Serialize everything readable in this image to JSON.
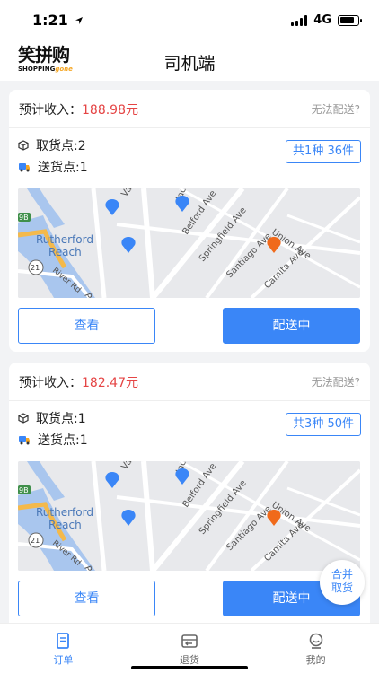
{
  "status_bar": {
    "time": "1:21",
    "network": "4G"
  },
  "header": {
    "logo_cn": "笑拼购",
    "logo_en_a": "SHOPPING",
    "logo_en_b": "gone",
    "title": "司机端"
  },
  "orders": [
    {
      "income_label": "预计收入：",
      "income_value": "188.98元",
      "no_delivery": "无法配送?",
      "pickup_points": "取货点:2",
      "delivery_points": "送货点:1",
      "summary": "共1种  36件",
      "view_label": "查看",
      "status_label": "配送中"
    },
    {
      "income_label": "预计收入：",
      "income_value": "182.47元",
      "no_delivery": "无法配送?",
      "pickup_points": "取货点:1",
      "delivery_points": "送货点:1",
      "summary": "共3种  50件",
      "view_label": "查看",
      "status_label": "配送中"
    }
  ],
  "map": {
    "labels": [
      "Rutherford",
      "Reach",
      "Vanderbilt",
      "Belford Ave",
      "Springfield Ave",
      "Santiago Ave",
      "Union Ave",
      "Camita Ave",
      "River Rd",
      "21",
      "9B",
      "Jackson",
      "Pa"
    ],
    "colors": {
      "land": "#e8e9ec",
      "water": "#a9c6ee",
      "road": "#ffffff",
      "pickup": "#3a86f7",
      "delivery": "#f06a1b",
      "highway": "#f4b94b"
    }
  },
  "merge_button": {
    "line1": "合并",
    "line2": "取货"
  },
  "tabbar": {
    "items": [
      {
        "label": "订单",
        "active": true
      },
      {
        "label": "退货",
        "active": false
      },
      {
        "label": "我的",
        "active": false
      }
    ]
  },
  "colors": {
    "accent": "#3a86f7",
    "price": "#e54545"
  }
}
